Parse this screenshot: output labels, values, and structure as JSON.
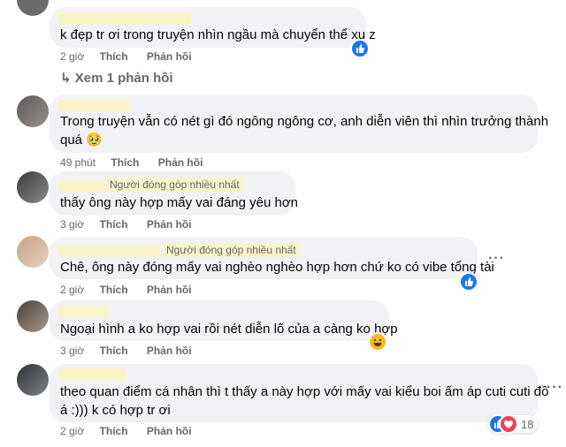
{
  "colors": {
    "bubble": "#f0f2f5",
    "secondary_text": "#65676b",
    "like_blue": "#1877f2",
    "haha_yellow": "#f7b928"
  },
  "actions": {
    "like": "Thích",
    "reply": "Phản hồi"
  },
  "view_replies": "Xem 1 phản hồi",
  "comments": [
    {
      "lines": [
        "k đẹp tr ơi trong truyện nhìn ngầu mà chuyển thể xu z"
      ],
      "time": "2 giờ",
      "reactions": [
        "like-icon"
      ]
    },
    {
      "lines": [
        "Trong truyện vẫn có nét gì đó ngông ngông cơ, anh diễn viên thì nhìn trưởng thành",
        "quá 🥹"
      ],
      "time": "49 phút"
    },
    {
      "badge": "Người đóng góp nhiều nhất",
      "lines": [
        "thấy ông này hợp mấy vai đáng yêu hơn"
      ],
      "time": "3 giờ"
    },
    {
      "badge": "Người đóng góp nhiều nhất",
      "lines": [
        "Chê, ông này đóng mấy vai nghèo nghèo hợp hơn chứ ko có vibe tổng tài"
      ],
      "time": "2 giờ",
      "reactions": [
        "like-icon"
      ]
    },
    {
      "lines": [
        "Ngoại hình a ko hợp vai rồi nét diễn lố của a càng ko hợp"
      ],
      "time": "3 giờ",
      "reactions": [
        "haha-icon"
      ]
    },
    {
      "lines": [
        "theo quan điểm cá nhân thì t thấy a này hợp với mấy vai kiểu boi ấm áp cuti cuti đồ",
        "á :))) k có hợp tr ơi"
      ],
      "time": "2 giờ",
      "reactions": [
        "like-icon",
        "love-icon"
      ],
      "reaction_count": "18"
    }
  ]
}
